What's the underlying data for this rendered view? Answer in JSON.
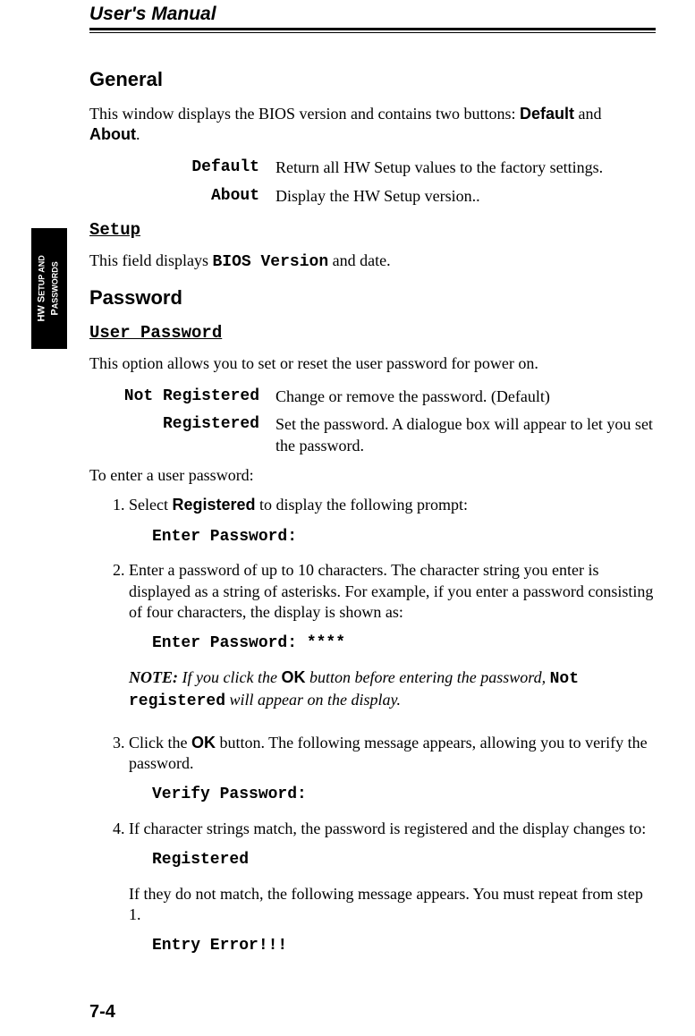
{
  "header": {
    "title": "User's Manual"
  },
  "sidetab": {
    "line": "HW SETUP AND PASSWORDS"
  },
  "section1": {
    "title": "General",
    "intro_pre": "This window displays the BIOS version and contains two buttons: ",
    "intro_b1": "Default",
    "intro_mid": " and ",
    "intro_b2": "About",
    "intro_post": ".",
    "defs": {
      "default_term": "Default",
      "default_desc": "Return all HW Setup values to the factory settings.",
      "about_term": "About",
      "about_desc": "Display the HW Setup version.."
    },
    "setup_title": "Setup",
    "setup_desc_pre": "This field displays ",
    "setup_desc_code": "BIOS Version",
    "setup_desc_post": " and date."
  },
  "section2": {
    "title": "Password",
    "userpw_title": "User Password",
    "intro": "This option allows you to set or reset the user password for power on.",
    "defs": {
      "unreg_term": "Not Registered",
      "unreg_desc": "Change or remove the password. (Default)",
      "reg_term": "Registered",
      "reg_desc": "Set the password. A dialogue box will appear to let you set the password."
    },
    "enter_intro": "To enter a user password:",
    "steps": {
      "s1_pre": "Select ",
      "s1_b": "Registered",
      "s1_post": " to display the following prompt:",
      "s1_prompt": "Enter Password:",
      "s2": "Enter a password of up to 10 characters. The character string you enter is displayed as a string of asterisks. For example, if you enter a password consisting of four characters, the display is shown as:",
      "s2_prompt": "Enter Password: ****",
      "note_lead": "NOTE:",
      "note_body_pre": " If you click the ",
      "note_ok": "OK",
      "note_body_mid": " button before entering the password, ",
      "note_code": "Not registered",
      "note_body_post": "  will appear on the display.",
      "s3_pre": "Click the ",
      "s3_ok": "OK",
      "s3_post": " button. The following message appears, allowing you to verify the password.",
      "s3_prompt": "Verify Password:",
      "s4": "If character strings match, the password is registered and the display changes to:",
      "s4_prompt": "Registered",
      "s4_post": "If they do not match, the following message appears. You must repeat from step 1.",
      "s4_prompt2": "Entry Error!!!"
    }
  },
  "footer": {
    "page": "7-4"
  }
}
